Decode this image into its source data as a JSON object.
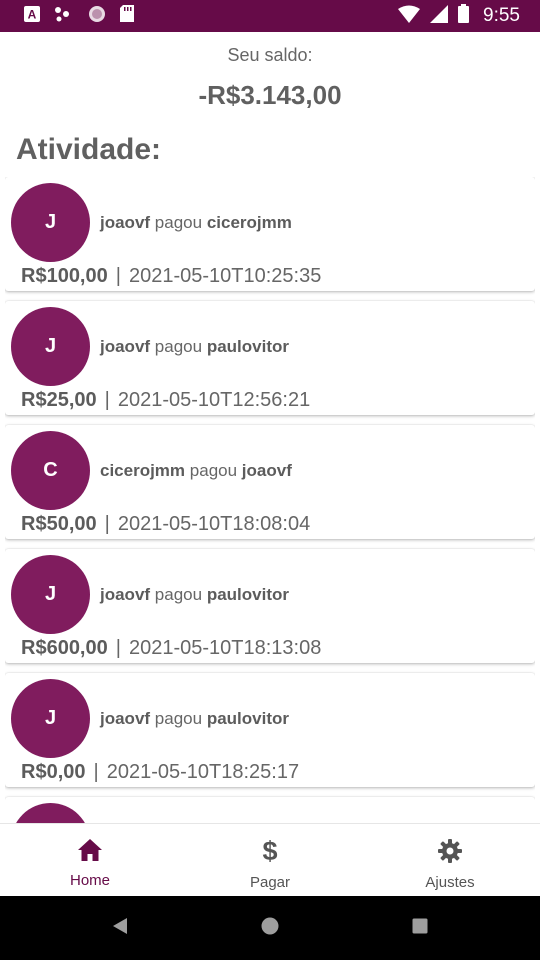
{
  "status_bar": {
    "time": "9:55",
    "icons": [
      "a-box-icon",
      "dots-icon",
      "circle-icon",
      "sd-card-icon",
      "wifi-icon",
      "signal-icon",
      "battery-icon"
    ]
  },
  "balance": {
    "label": "Seu saldo:",
    "value": "-R$3.143,00"
  },
  "activity": {
    "title": "Atividade:",
    "items": [
      {
        "initial": "J",
        "from": "joaovf",
        "verb": "pagou",
        "to": "cicerojmm",
        "amount": "R$100,00",
        "timestamp": "2021-05-10T10:25:35"
      },
      {
        "initial": "J",
        "from": "joaovf",
        "verb": "pagou",
        "to": "paulovitor",
        "amount": "R$25,00",
        "timestamp": "2021-05-10T12:56:21"
      },
      {
        "initial": "C",
        "from": "cicerojmm",
        "verb": "pagou",
        "to": "joaovf",
        "amount": "R$50,00",
        "timestamp": "2021-05-10T18:08:04"
      },
      {
        "initial": "J",
        "from": "joaovf",
        "verb": "pagou",
        "to": "paulovitor",
        "amount": "R$600,00",
        "timestamp": "2021-05-10T18:13:08"
      },
      {
        "initial": "J",
        "from": "joaovf",
        "verb": "pagou",
        "to": "paulovitor",
        "amount": "R$0,00",
        "timestamp": "2021-05-10T18:25:17"
      }
    ],
    "separator": "|"
  },
  "bottom_nav": {
    "items": [
      {
        "label": "Home",
        "icon": "home-icon",
        "active": true
      },
      {
        "label": "Pagar",
        "icon": "dollar-icon",
        "active": false
      },
      {
        "label": "Ajustes",
        "icon": "gear-icon",
        "active": false
      }
    ]
  },
  "colors": {
    "primary": "#660b48",
    "avatar": "#801c5e",
    "text": "#5f5f5f"
  }
}
